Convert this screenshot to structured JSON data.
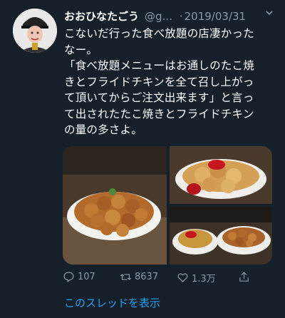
{
  "tweet": {
    "display_name": "おおひなたごう",
    "handle": "@g...",
    "separator": "·",
    "date": "2019/03/31",
    "more_icon": "chevron-down-icon",
    "text": "こないだ行った食べ放題の店凄かった\nなー。\n「食べ放題メニューはお通しのたこ焼\nきとフライドチキンを全て召し上がっ\nて頂いてからご注文出来ます」と言っ\nて出されたたこ焼きとフライドチキン\nの量の多さよ。",
    "actions": {
      "replies": "107",
      "retweets": "8637",
      "likes": "1.3万"
    },
    "show_thread": "このスレッドを表示"
  },
  "colors": {
    "background": "#15202b",
    "secondary_text": "#8899a6",
    "link": "#1da1f2"
  }
}
